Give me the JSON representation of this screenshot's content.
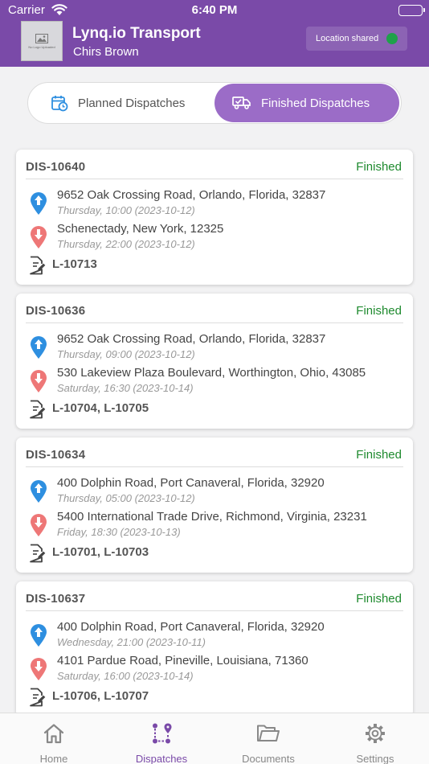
{
  "status_bar": {
    "carrier": "Carrier",
    "time": "6:40 PM"
  },
  "header": {
    "logo_text": "No Logo Uploaded",
    "title": "Lynq.io Transport",
    "user": "Chirs Brown",
    "location_label": "Location shared",
    "location_color": "#1fa14a"
  },
  "segments": {
    "planned": "Planned Dispatches",
    "finished": "Finished Dispatches",
    "selected": "finished"
  },
  "dispatches": [
    {
      "id": "DIS-10640",
      "status": "Finished",
      "pickup": {
        "address": "9652 Oak Crossing Road, Orlando, Florida, 32837",
        "time": "Thursday, 10:00 (2023-10-12)"
      },
      "dropoff": {
        "address": "Schenectady, New York, 12325",
        "time": "Thursday, 22:00 (2023-10-12)"
      },
      "loads": "L-10713"
    },
    {
      "id": "DIS-10636",
      "status": "Finished",
      "pickup": {
        "address": "9652 Oak Crossing Road, Orlando, Florida, 32837",
        "time": "Thursday, 09:00 (2023-10-12)"
      },
      "dropoff": {
        "address": "530 Lakeview Plaza Boulevard, Worthington, Ohio, 43085",
        "time": "Saturday, 16:30 (2023-10-14)"
      },
      "loads": "L-10704, L-10705"
    },
    {
      "id": "DIS-10634",
      "status": "Finished",
      "pickup": {
        "address": "400 Dolphin Road, Port Canaveral, Florida, 32920",
        "time": "Thursday, 05:00 (2023-10-12)"
      },
      "dropoff": {
        "address": "5400 International Trade Drive, Richmond, Virginia, 23231",
        "time": "Friday, 18:30 (2023-10-13)"
      },
      "loads": "L-10701, L-10703"
    },
    {
      "id": "DIS-10637",
      "status": "Finished",
      "pickup": {
        "address": "400 Dolphin Road, Port Canaveral, Florida, 32920",
        "time": "Wednesday, 21:00 (2023-10-11)"
      },
      "dropoff": {
        "address": "4101 Pardue Road, Pineville, Louisiana, 71360",
        "time": "Saturday, 16:00 (2023-10-14)"
      },
      "loads": "L-10706, L-10707"
    }
  ],
  "tabbar": {
    "items": [
      {
        "label": "Home",
        "icon": "home-icon"
      },
      {
        "label": "Dispatches",
        "icon": "dispatches-icon"
      },
      {
        "label": "Documents",
        "icon": "folder-icon"
      },
      {
        "label": "Settings",
        "icon": "gear-icon"
      }
    ],
    "active": "Dispatches"
  },
  "colors": {
    "brand": "#7a4aa8",
    "segment_active": "#9b6cc7",
    "status_finished": "#1e8a2e",
    "pickup_pin": "#2e8fe0",
    "dropoff_pin": "#ee7777"
  }
}
